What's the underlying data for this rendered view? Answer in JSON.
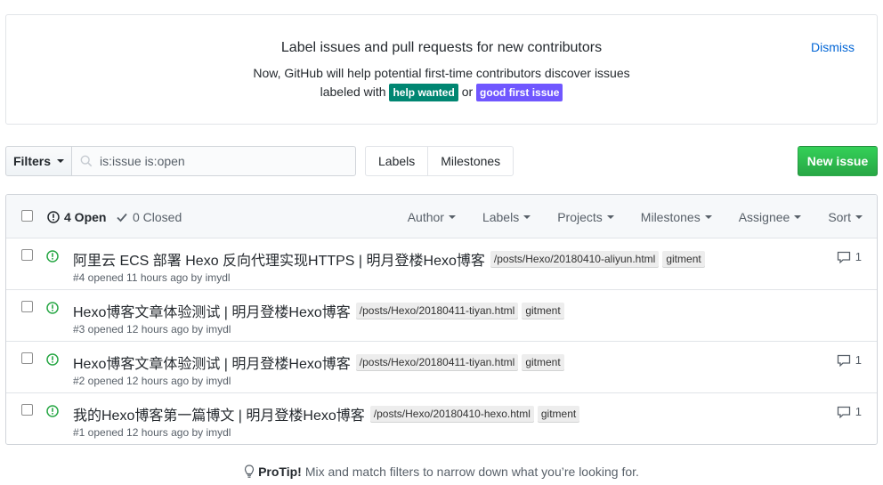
{
  "banner": {
    "title": "Label issues and pull requests for new contributors",
    "desc_line1": "Now, GitHub will help potential first-time contributors discover issues",
    "desc_prefix": "labeled with",
    "label1": "help wanted",
    "label1_color": "#008672",
    "or_text": "or",
    "label2": "good first issue",
    "label2_color": "#7057ff",
    "dismiss": "Dismiss"
  },
  "toolbar": {
    "filters_label": "Filters",
    "search_value": "is:issue is:open",
    "labels_link": "Labels",
    "milestones_link": "Milestones",
    "new_issue": "New issue"
  },
  "header": {
    "open_count": "4 Open",
    "closed_count": "0 Closed",
    "sorters": [
      "Author",
      "Labels",
      "Projects",
      "Milestones",
      "Assignee",
      "Sort"
    ]
  },
  "issues": [
    {
      "title": "阿里云 ECS 部署 Hexo 反向代理实现HTTPS | 明月登楼Hexo博客",
      "path_label": "/posts/Hexo/20180410-aliyun.html",
      "gitment_label": "gitment",
      "meta": "#4 opened 11 hours ago by imydl",
      "comments": "1"
    },
    {
      "title": "Hexo博客文章体验测试 | 明月登楼Hexo博客",
      "path_label": "/posts/Hexo/20180411-tiyan.html",
      "gitment_label": "gitment",
      "meta": "#3 opened 12 hours ago by imydl",
      "comments": ""
    },
    {
      "title": "Hexo博客文章体验测试 | 明月登楼Hexo博客",
      "path_label": "/posts/Hexo/20180411-tiyan.html",
      "gitment_label": "gitment",
      "meta": "#2 opened 12 hours ago by imydl",
      "comments": "1"
    },
    {
      "title": "我的Hexo博客第一篇博文 | 明月登楼Hexo博客",
      "path_label": "/posts/Hexo/20180410-hexo.html",
      "gitment_label": "gitment",
      "meta": "#1 opened 12 hours ago by imydl",
      "comments": "1"
    }
  ],
  "protip": {
    "bold": "ProTip!",
    "text": "Mix and match filters to narrow down what you’re looking for."
  }
}
